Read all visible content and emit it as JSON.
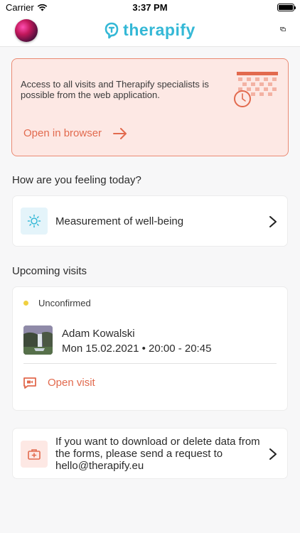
{
  "status_bar": {
    "carrier": "Carrier",
    "time": "3:37 PM"
  },
  "nav": {
    "logo_text": "therapify",
    "brand_color": "#34b8d6"
  },
  "banner": {
    "text": "Access to all visits and Therapify specialists is possible from the web application.",
    "link_label": "Open in browser",
    "accent": "#e26a4e"
  },
  "feeling": {
    "section_title": "How are you feeling today?",
    "card_label": "Measurement of well-being"
  },
  "visits": {
    "section_title": "Upcoming visits",
    "items": [
      {
        "status": "Unconfirmed",
        "name": "Adam Kowalski",
        "datetime": "Mon 15.02.2021 • 20:00 - 20:45",
        "action_label": "Open visit"
      }
    ]
  },
  "data_request": {
    "text": "If you want to download or delete data from the forms, please send a request to hello@therapify.eu"
  }
}
